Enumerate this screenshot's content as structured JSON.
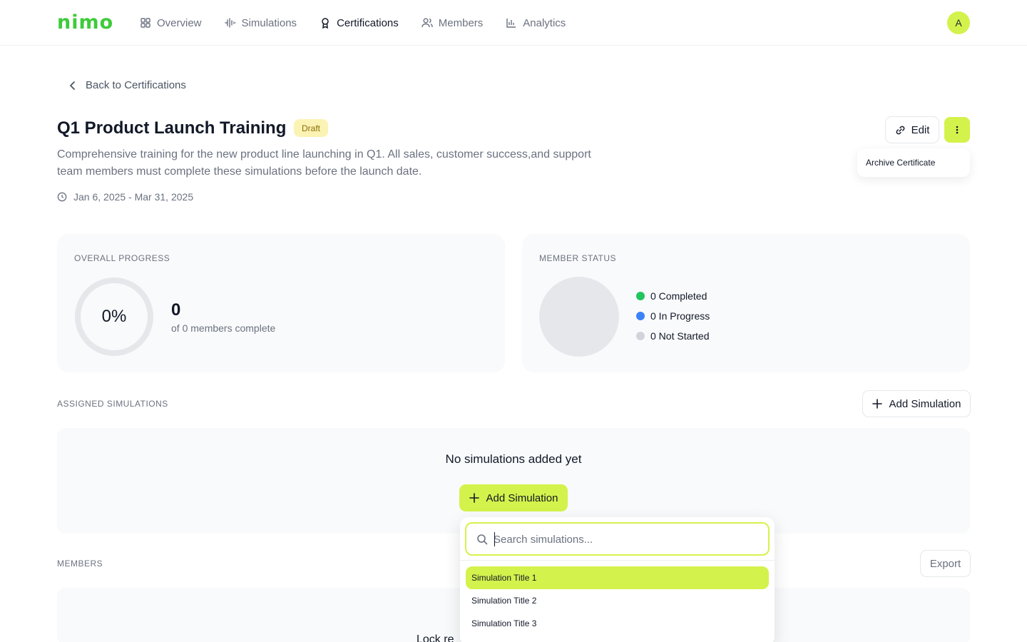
{
  "brand": {
    "logo": "nimo",
    "accent": "#d4f24c",
    "logo_color": "#3ecb3a"
  },
  "nav": {
    "items": [
      {
        "label": "Overview",
        "icon": "grid-icon"
      },
      {
        "label": "Simulations",
        "icon": "waveform-icon"
      },
      {
        "label": "Certifications",
        "icon": "award-icon",
        "active": true
      },
      {
        "label": "Members",
        "icon": "users-icon"
      },
      {
        "label": "Analytics",
        "icon": "bar-chart-icon"
      }
    ],
    "avatar_initial": "A"
  },
  "back_link": "Back to Certifications",
  "certificate": {
    "title": "Q1 Product Launch Training",
    "status": "Draft",
    "description": "Comprehensive training for the new product line launching in Q1. All sales, customer success,and support team members must complete these simulations before the launch date.",
    "date_range": "Jan 6, 2025 - Mar 31, 2025"
  },
  "actions": {
    "edit_label": "Edit",
    "more_menu": {
      "items": [
        "Archive Certificate"
      ]
    }
  },
  "overall_progress": {
    "label": "OVERALL PROGRESS",
    "percent_text": "0%",
    "percent": 0,
    "count": "0",
    "subtitle": "of 0 members complete"
  },
  "member_status": {
    "label": "MEMBER STATUS",
    "legend": [
      {
        "text": "0 Completed",
        "color": "#22c55e"
      },
      {
        "text": "0 In Progress",
        "color": "#3b82f6"
      },
      {
        "text": "0 Not Started",
        "color": "#d1d5db"
      }
    ]
  },
  "assigned_simulations": {
    "label": "ASSIGNED SIMULATIONS",
    "add_label": "Add Simulation",
    "empty_text": "No simulations added yet",
    "empty_add_label": "Add Simulation"
  },
  "simulation_picker": {
    "search_placeholder": "Search simulations...",
    "search_value": "",
    "options": [
      "Simulation Title 1",
      "Simulation Title 2",
      "Simulation Title 3"
    ],
    "selected_index": 0
  },
  "members": {
    "label": "MEMBERS",
    "export_label": "Export",
    "partial_text": "Lock re"
  }
}
